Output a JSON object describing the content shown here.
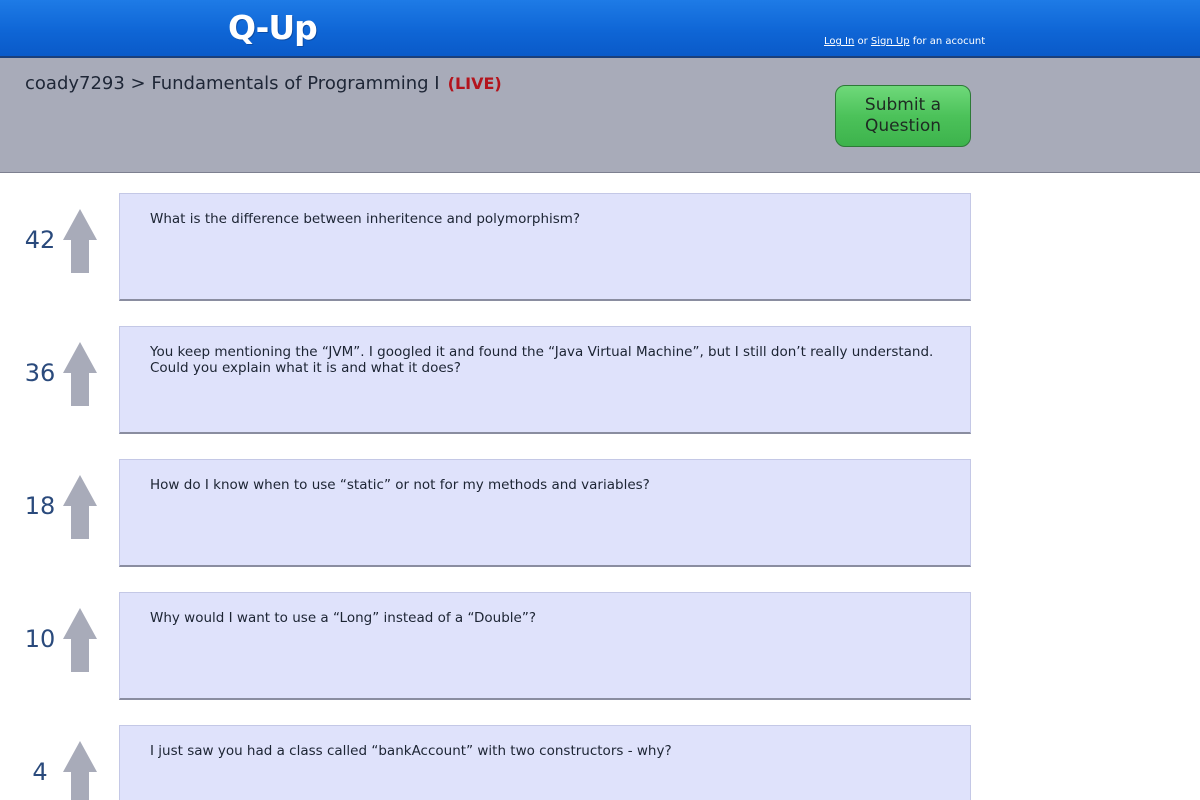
{
  "app": {
    "logo": "Q-Up",
    "auth": {
      "login": "Log In",
      "or": " or ",
      "signup": "Sign Up",
      "suffix": " for an acocunt"
    }
  },
  "header": {
    "breadcrumb": "coady7293 > Fundamentals of Programming I",
    "live": "(LIVE)",
    "submit_label": "Submit a Question"
  },
  "questions": [
    {
      "votes": "42",
      "text": "What is the difference between inheritence and polymorphism?"
    },
    {
      "votes": "36",
      "text": "You keep mentioning the “JVM”. I googled it and found the “Java Virtual Machine”, but I still don’t really understand. Could you explain what it is and what it does?"
    },
    {
      "votes": "18",
      "text": "How do I know when to use “static” or not for my methods and variables?"
    },
    {
      "votes": "10",
      "text": "Why would I want to use a “Long” instead of a “Double”?"
    },
    {
      "votes": "4",
      "text": "I just saw you had a class called “bankAccount” with two constructors - why?"
    }
  ],
  "colors": {
    "topbar": "#0f66d6",
    "header": "#a8abb9",
    "submit": "#4cc25a",
    "card": "#dfe2fb",
    "upvote_arrow": "#a8abb9",
    "live": "#b3141d",
    "votes": "#2a4a7c"
  },
  "icons": {
    "upvote": "upvote-arrow-icon"
  }
}
